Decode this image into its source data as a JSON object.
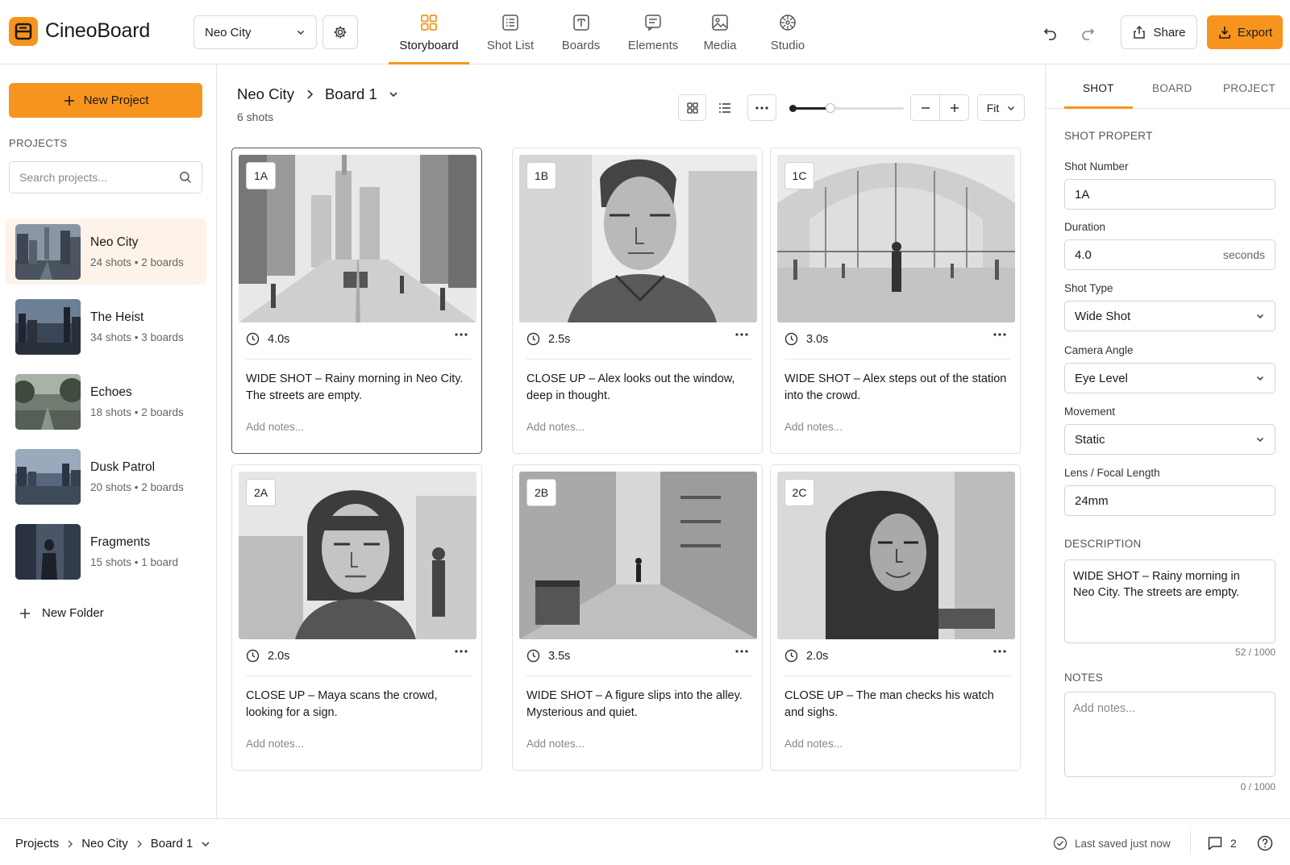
{
  "app": {
    "name": "CineoBoard",
    "accent": "#f7941d"
  },
  "header": {
    "project_select": "Neo City",
    "nav": [
      {
        "label": "Storyboard",
        "icon": "storyboard-grid-icon",
        "active": true
      },
      {
        "label": "Shot List",
        "icon": "shot-list-icon"
      },
      {
        "label": "Boards",
        "icon": "boards-icon"
      },
      {
        "label": "Elements",
        "icon": "elements-icon"
      },
      {
        "label": "Media",
        "icon": "media-icon"
      },
      {
        "label": "Studio",
        "icon": "studio-icon"
      }
    ],
    "share_label": "Share",
    "export_label": "Export"
  },
  "sidebar": {
    "new_project_label": "New Project",
    "projects_heading": "PROJECTS",
    "search_placeholder": "Search projects...",
    "projects": [
      {
        "name": "Neo City",
        "meta": "24 shots • 2 boards",
        "active": true
      },
      {
        "name": "The Heist",
        "meta": "34 shots • 3 boards"
      },
      {
        "name": "Echoes",
        "meta": "18 shots • 2 boards"
      },
      {
        "name": "Dusk Patrol",
        "meta": "20 shots • 2 boards"
      },
      {
        "name": "Fragments",
        "meta": "15 shots • 1 board"
      }
    ],
    "new_folder_label": "New Folder"
  },
  "main": {
    "breadcrumb": {
      "project": "Neo City",
      "board": "Board 1"
    },
    "shot_count": "6 shots",
    "zoom_fit": "Fit",
    "zoom_level": 0.35,
    "shots": [
      {
        "id": "1A",
        "duration": "4.0s",
        "desc_line1": "WIDE SHOT – Rainy morning in Neo City.",
        "desc_line2": "The streets are empty.",
        "notes": "Add notes...",
        "image": "rainy-city-street-sketch"
      },
      {
        "id": "1B",
        "duration": "2.5s",
        "desc_line1": "CLOSE UP – Alex looks out the window,",
        "desc_line2": "deep in thought.",
        "notes": "Add notes...",
        "image": "man-portrait-sketch"
      },
      {
        "id": "1C",
        "duration": "3.0s",
        "desc_line1": "WIDE SHOT – Alex steps out of the station",
        "desc_line2": "into the crowd.",
        "notes": "Add notes...",
        "image": "station-hall-sketch"
      },
      {
        "id": "2A",
        "duration": "2.0s",
        "desc_line1": "CLOSE UP – Maya scans the crowd,",
        "desc_line2": "looking for a sign.",
        "notes": "Add notes...",
        "image": "woman-portrait-sketch"
      },
      {
        "id": "2B",
        "duration": "3.5s",
        "desc_line1": "WIDE SHOT – A figure slips into the alley.",
        "desc_line2": "Mysterious and quiet.",
        "notes": "Add notes...",
        "image": "alley-sketch"
      },
      {
        "id": "2C",
        "duration": "2.0s",
        "desc_line1": "CLOSE UP – The man checks his watch",
        "desc_line2": "and sighs.",
        "notes": "Add notes...",
        "image": "hooded-man-sketch"
      }
    ]
  },
  "panel": {
    "tabs": [
      {
        "label": "SHOT",
        "active": true
      },
      {
        "label": "BOARD"
      },
      {
        "label": "PROJECT"
      }
    ],
    "section_props": "SHOT PROPERT",
    "shot_number_label": "Shot Number",
    "shot_number": "1A",
    "duration_label": "Duration",
    "duration": "4.0",
    "duration_unit": "seconds",
    "shot_type_label": "Shot Type",
    "shot_type": "Wide Shot",
    "camera_angle_label": "Camera Angle",
    "camera_angle": "Eye Level",
    "movement_label": "Movement",
    "movement": "Static",
    "lens_label": "Lens / Focal Length",
    "lens": "24mm",
    "description_heading": "DESCRIPTION",
    "description_line1": "WIDE SHOT – Rainy morning in",
    "description_line2": "Neo City. The streets are empty.",
    "description_count": "52 / 1000",
    "notes_heading": "NOTES",
    "notes_placeholder": "Add notes...",
    "notes_count": "0 / 1000"
  },
  "status": {
    "crumb_root": "Projects",
    "crumb_project": "Neo City",
    "crumb_board": "Board 1",
    "saved": "Last saved just now",
    "comments": "2"
  }
}
